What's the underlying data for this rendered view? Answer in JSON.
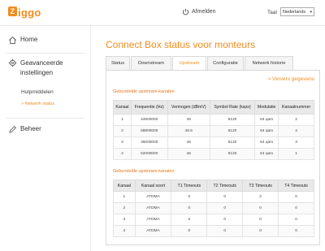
{
  "header": {
    "logo_text": "iggo",
    "logo_letter": "Z",
    "logout_label": "Afmelden",
    "language_label": "Taal",
    "language_value": "Nederlands"
  },
  "sidebar": {
    "home": "Home",
    "advanced_line1": "Geavanceerde",
    "advanced_line2": "instellingen",
    "help": "Hulpmiddelen",
    "network_status": "> Netwerk status",
    "beheer": "Beheer"
  },
  "page": {
    "title": "Connect Box status voor monteurs",
    "refresh": "> Ververs gegevens"
  },
  "tabs": [
    {
      "label": "Status",
      "active": false
    },
    {
      "label": "Downstream",
      "active": false
    },
    {
      "label": "Upstream",
      "active": true
    },
    {
      "label": "Configuratie",
      "active": false
    },
    {
      "label": "Netwerk historie",
      "active": false
    }
  ],
  "table1": {
    "title": "Gebundelde upstream-kanalen",
    "headers": [
      "Kanaal",
      "Frequentie (Hz)",
      "Vermogen (dBmV)",
      "Symbol Rate (ksps)",
      "Modulatie",
      "Kanaalnummer"
    ],
    "rows": [
      [
        "1",
        "44500000",
        "46",
        "5120",
        "64 qam",
        "2"
      ],
      [
        "2",
        "58800000",
        "46.5",
        "5120",
        "64 qam",
        "4"
      ],
      [
        "3",
        "36000000",
        "46",
        "5120",
        "64 qam",
        "3"
      ],
      [
        "4",
        "52000000",
        "46",
        "5120",
        "64 qam",
        "1"
      ]
    ]
  },
  "table2": {
    "title": "Gebundelde upstream-kanalen",
    "headers": [
      "Kanaal",
      "Kanaal soort",
      "T1 Timeouts",
      "T2 Timeouts",
      "T3 Timeouts",
      "T4 Timeouts"
    ],
    "rows": [
      [
        "1",
        "ATDMA",
        "0",
        "0",
        "2",
        "0"
      ],
      [
        "2",
        "ATDMA",
        "0",
        "0",
        "0",
        "0"
      ],
      [
        "3",
        "ATDMA",
        "0",
        "0",
        "0",
        "0"
      ],
      [
        "4",
        "ATDMA",
        "0",
        "0",
        "0",
        "0"
      ]
    ]
  },
  "colors": {
    "accent": "#f48c1e"
  }
}
